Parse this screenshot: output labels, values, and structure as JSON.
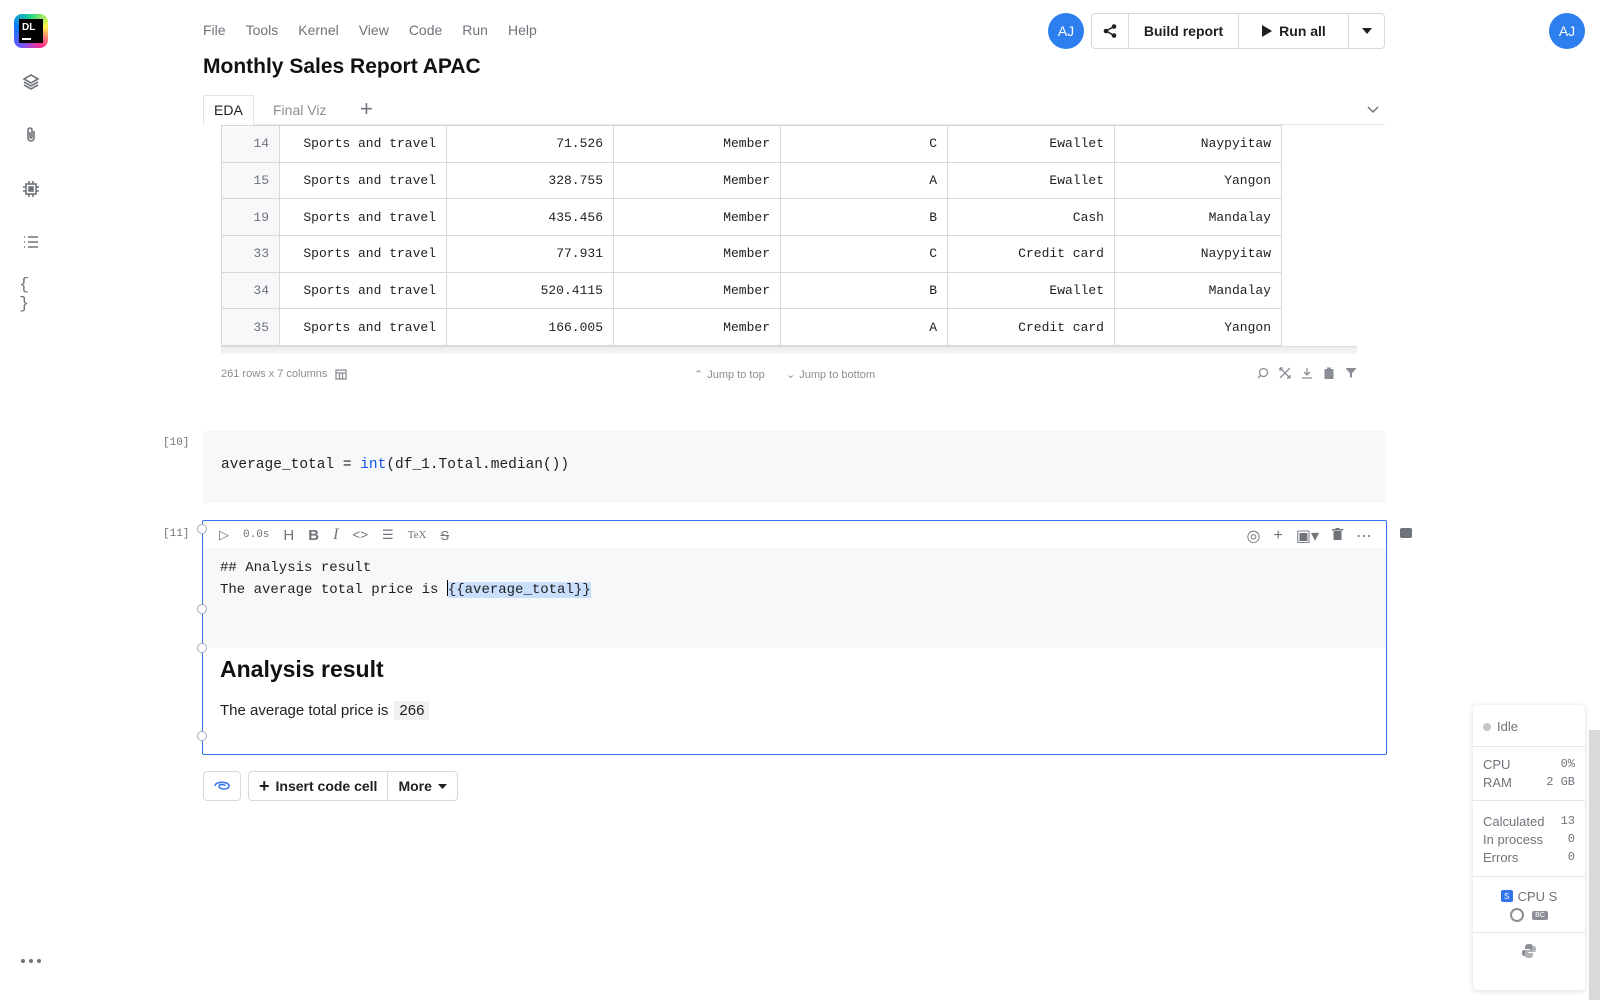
{
  "app": {
    "logo_text": "DL",
    "menu": [
      "File",
      "Tools",
      "Kernel",
      "View",
      "Code",
      "Run",
      "Help"
    ],
    "notebook_title": "Monthly Sales Report APAC",
    "collaborator_initials": "AJ",
    "user_initials": "AJ"
  },
  "toolbar": {
    "build_report": "Build report",
    "run_all": "Run all"
  },
  "tabs": [
    {
      "label": "EDA",
      "active": true
    },
    {
      "label": "Final Viz",
      "active": false
    }
  ],
  "table": {
    "rows": [
      [
        "14",
        "Sports and travel",
        "71.526",
        "Member",
        "C",
        "Ewallet",
        "Naypyitaw"
      ],
      [
        "15",
        "Sports and travel",
        "328.755",
        "Member",
        "A",
        "Ewallet",
        "Yangon"
      ],
      [
        "19",
        "Sports and travel",
        "435.456",
        "Member",
        "B",
        "Cash",
        "Mandalay"
      ],
      [
        "33",
        "Sports and travel",
        "77.931",
        "Member",
        "C",
        "Credit card",
        "Naypyitaw"
      ],
      [
        "34",
        "Sports and travel",
        "520.4115",
        "Member",
        "B",
        "Ewallet",
        "Mandalay"
      ],
      [
        "35",
        "Sports and travel",
        "166.005",
        "Member",
        "A",
        "Credit card",
        "Yangon"
      ]
    ],
    "rows_info": "261 rows x 7 columns",
    "jump_top": "Jump to top",
    "jump_bottom": "Jump to bottom"
  },
  "cells": {
    "code_exec": "[10]",
    "code_source": {
      "prefix": "average_total = ",
      "keyword": "int",
      "suffix": "(df_1.Total.median())"
    },
    "md_exec": "[11]",
    "md_time": "0.0s",
    "md_source_line1": "## Analysis result",
    "md_source_line2_prefix": "The average total price is ",
    "md_source_line2_selected": "{{average_total}}",
    "md_rendered_heading": "Analysis result",
    "md_rendered_text": "The average total price is",
    "md_rendered_value": "266"
  },
  "actions": {
    "insert_code_cell": "Insert code cell",
    "more": "More"
  },
  "status": {
    "state": "Idle",
    "cpu_label": "CPU",
    "cpu_value": "0%",
    "ram_label": "RAM",
    "ram_value": "2 GB",
    "calculated_label": "Calculated",
    "calculated_value": "13",
    "in_process_label": "In process",
    "in_process_value": "0",
    "errors_label": "Errors",
    "errors_value": "0",
    "machine": "CPU S",
    "machine_badge": "S",
    "gpu_badge": "BC"
  },
  "colors": {
    "accent": "#3574f0",
    "avatar": "#2d7ff0"
  }
}
